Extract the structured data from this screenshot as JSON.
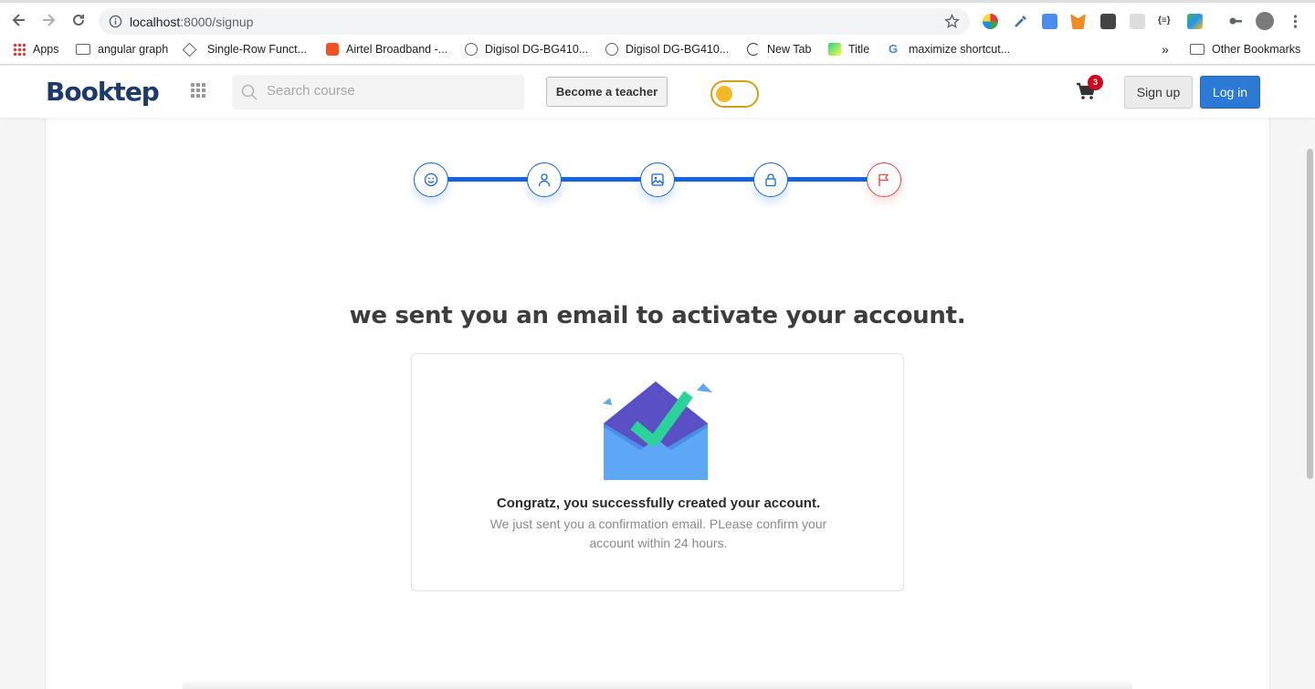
{
  "browser": {
    "url_host": "localhost",
    "url_path": ":8000/signup",
    "bookmarks": [
      {
        "label": "Apps",
        "icon": "apps-grid-icon"
      },
      {
        "label": "angular graph",
        "icon": "folder-icon"
      },
      {
        "label": "Single-Row Funct...",
        "icon": "diamond-icon"
      },
      {
        "label": "Airtel Broadband -...",
        "icon": "blogger-icon"
      },
      {
        "label": "Digisol DG-BG410...",
        "icon": "antenna-icon"
      },
      {
        "label": "Digisol DG-BG410...",
        "icon": "antenna-icon"
      },
      {
        "label": "New Tab",
        "icon": "refresh-circle-icon"
      },
      {
        "label": "Title",
        "icon": "pycharm-icon"
      },
      {
        "label": "maximize shortcut...",
        "icon": "google-icon"
      }
    ],
    "more_bookmarks": "»",
    "other_bookmarks": "Other Bookmarks"
  },
  "header": {
    "logo_text": "Booktep",
    "search_placeholder": "Search course",
    "become_teacher": "Become a teacher",
    "cart_count": "3",
    "signup": "Sign up",
    "login": "Log in"
  },
  "stepper": {
    "steps": [
      {
        "icon": "smiley-icon",
        "color": "#1565e0"
      },
      {
        "icon": "user-icon",
        "color": "#1565e0"
      },
      {
        "icon": "image-icon",
        "color": "#1565e0"
      },
      {
        "icon": "lock-icon",
        "color": "#1565e0"
      },
      {
        "icon": "flag-icon",
        "color": "#e94848"
      }
    ]
  },
  "main": {
    "heading": "we sent you an email to activate your account.",
    "card_title": "Congratz, you successfully created your account.",
    "card_text": "We just sent you a confirmation email. PLease confirm your account within 24 hours."
  }
}
